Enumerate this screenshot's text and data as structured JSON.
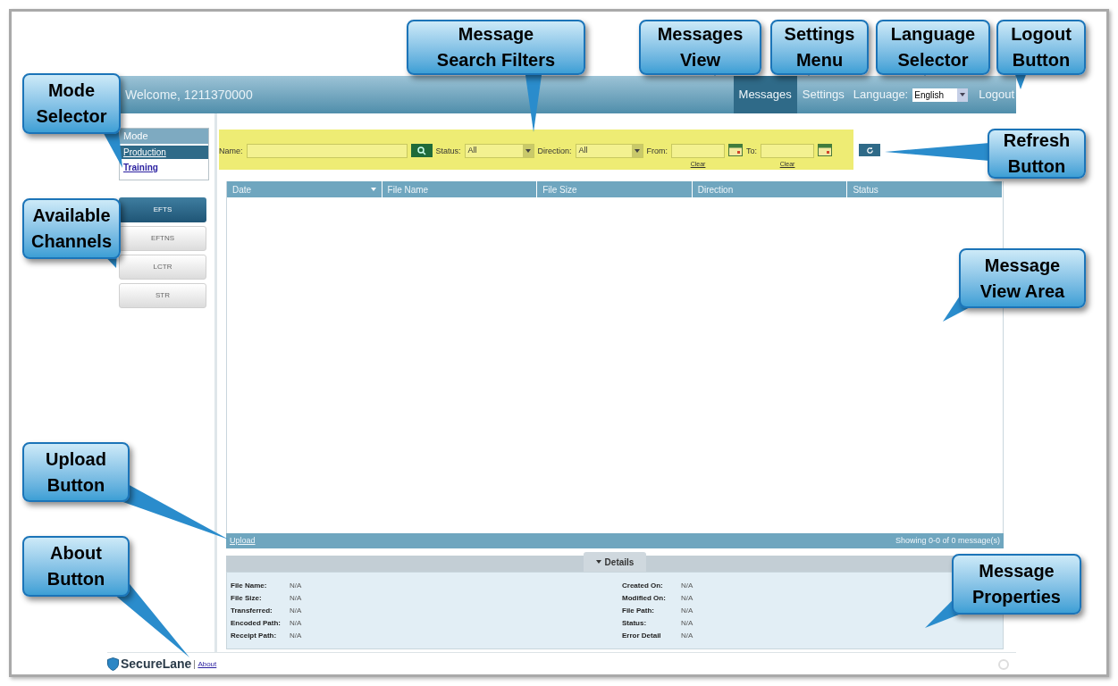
{
  "header": {
    "welcome": "Welcome, 1211370000",
    "nav": [
      {
        "label": "Messages",
        "selected": true
      },
      {
        "label": "Settings",
        "selected": false
      }
    ],
    "language": {
      "label": "Language:",
      "value": "English"
    },
    "logout": "Logout"
  },
  "mode": {
    "title": "Mode",
    "items": [
      {
        "label": "Production",
        "selected": true
      },
      {
        "label": "Training",
        "selected": false
      }
    ]
  },
  "channels": [
    {
      "label": "EFTS",
      "selected": true
    },
    {
      "label": "EFTNS",
      "selected": false
    },
    {
      "label": "LCTR",
      "selected": false
    },
    {
      "label": "STR",
      "selected": false
    }
  ],
  "filters": {
    "name_label": "Name:",
    "status_label": "Status:",
    "status_value": "All",
    "direction_label": "Direction:",
    "direction_value": "All",
    "from_label": "From:",
    "from_clear": "Clear",
    "to_label": "To:",
    "to_clear": "Clear"
  },
  "table": {
    "columns": [
      {
        "label": "Date",
        "sorted": true
      },
      {
        "label": "File Name",
        "sorted": false
      },
      {
        "label": "File Size",
        "sorted": false
      },
      {
        "label": "Direction",
        "sorted": false
      },
      {
        "label": "Status",
        "sorted": false
      }
    ]
  },
  "table_footer": {
    "upload": "Upload",
    "showing": "Showing 0-0 of 0 message(s)"
  },
  "details": {
    "tab": "Details",
    "expanded": true,
    "left": [
      {
        "label": "File Name:",
        "value": "N/A"
      },
      {
        "label": "File Size:",
        "value": "N/A"
      },
      {
        "label": "Transferred:",
        "value": "N/A"
      },
      {
        "label": "Encoded Path:",
        "value": "N/A"
      },
      {
        "label": "Receipt Path:",
        "value": "N/A"
      }
    ],
    "right": [
      {
        "label": "Created On:",
        "value": "N/A"
      },
      {
        "label": "Modified On:",
        "value": "N/A"
      },
      {
        "label": "File Path:",
        "value": "N/A"
      },
      {
        "label": "Status:",
        "value": "N/A"
      },
      {
        "label": "Error Detail",
        "value": "N/A"
      }
    ]
  },
  "footer": {
    "logo": "SecureLane",
    "about": "About"
  },
  "callouts": [
    "Mode\nSelector",
    "Message\nSearch Filters",
    "Messages\nView",
    "Settings\nMenu",
    "Language\nSelector",
    "Logout\nButton",
    "Refresh\nButton",
    "Available\nChannels",
    "Message\nView Area",
    "Upload\nButton",
    "About\nButton",
    "Message\nProperties"
  ]
}
